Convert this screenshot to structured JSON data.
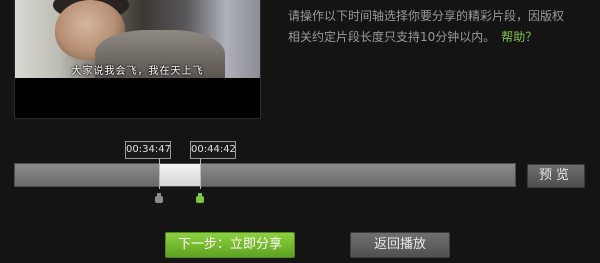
{
  "video": {
    "subtitle": "大家说我会飞，我在天上飞"
  },
  "instructions": {
    "text": "请操作以下时间轴选择你要分享的精彩片段，因版权相关约定片段长度只支持10分钟以内。",
    "help_link": "帮助？"
  },
  "timeline": {
    "start_time": "00:34:47",
    "end_time": "00:44:42",
    "selection_start_fraction": 0.29,
    "selection_end_fraction": 0.37
  },
  "buttons": {
    "preview": "预览",
    "next": "下一步：立即分享",
    "back": "返回播放"
  },
  "colors": {
    "accent_green": "#7cc63b",
    "background": "#141414",
    "help_link": "#86c440"
  }
}
